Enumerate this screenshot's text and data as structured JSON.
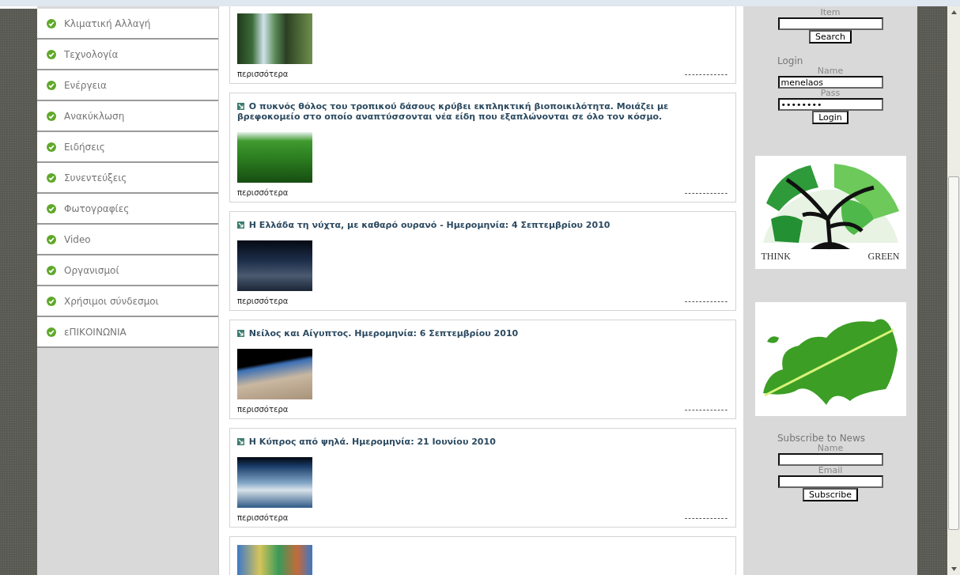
{
  "menu": [
    {
      "label": "Κλιματική Αλλαγή"
    },
    {
      "label": "Τεχνολογία"
    },
    {
      "label": "Ενέργεια"
    },
    {
      "label": "Ανακύκλωση"
    },
    {
      "label": "Ειδήσεις"
    },
    {
      "label": "Συνεντεύξεις"
    },
    {
      "label": "Φωτογραφίες"
    },
    {
      "label": "Video"
    },
    {
      "label": "Οργανισμοί"
    },
    {
      "label": "Χρήσιμοι σύνδεσμοι"
    },
    {
      "label": "εΠΙΚΟΙΝΩΝΙΑ"
    }
  ],
  "articles": [
    {
      "kind": "waterfall",
      "more": "περισσότερα",
      "rating": "------------"
    },
    {
      "title": "Ο πυκνός θόλος του τροπικού δάσους κρύβει εκπληκτική βιοποικιλότητα. Μοιάζει με βρεφοκομείο στο οποίο αναπτύσσονται νέα είδη που εξαπλώνονται σε όλο τον κόσμο.",
      "kind": "forest",
      "more": "περισσότερα",
      "rating": "------------"
    },
    {
      "title": "Η Ελλάδα τη νύχτα, με καθαρό ουρανό - Ημερομηνία: 4 Σεπτεμβρίου 2010",
      "kind": "night",
      "more": "περισσότερα",
      "rating": "------------"
    },
    {
      "title": "Νείλος και Αίγυπτος. Ημερομηνία: 6 Σεπτεμβρίου 2010",
      "kind": "nile",
      "more": "περισσότερα",
      "rating": "------------"
    },
    {
      "title": "Η Κύπρος από ψηλά. Ημερομηνία: 21 Ιουνίου 2010",
      "kind": "cyprus",
      "more": "περισσότερα",
      "rating": "------------"
    },
    {
      "kind": "map"
    }
  ],
  "search": {
    "label": "Item",
    "button": "Search"
  },
  "login": {
    "heading": "Login",
    "name_label": "Name",
    "name_value": "menelaos",
    "pass_label": "Pass",
    "pass_value": "••••••••",
    "button": "Login"
  },
  "logo": {
    "words": [
      "THINK",
      "GREEN"
    ]
  },
  "subscribe": {
    "heading": "Subscribe to News",
    "name_label": "Name",
    "email_label": "Email",
    "button": "Subscribe"
  }
}
